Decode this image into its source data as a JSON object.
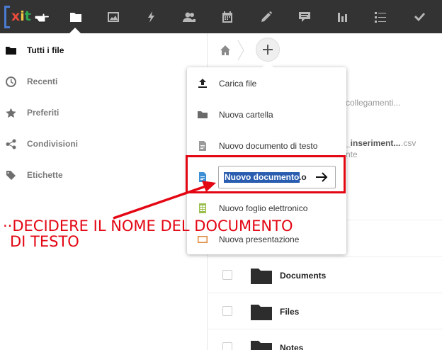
{
  "app": {
    "logo_text": "xit",
    "nav": [
      {
        "icon": "folder-icon",
        "active": true
      },
      {
        "icon": "image-icon"
      },
      {
        "icon": "activity-bolt-icon"
      },
      {
        "icon": "contacts-icon"
      },
      {
        "icon": "calendar-icon"
      },
      {
        "icon": "pencil-icon"
      },
      {
        "icon": "chat-icon"
      },
      {
        "icon": "bar-chart-icon"
      },
      {
        "icon": "list-icon"
      },
      {
        "icon": "checkmark-icon"
      }
    ]
  },
  "sidebar": {
    "items": [
      {
        "label": "Tutti i file",
        "icon": "folder-icon",
        "active": true
      },
      {
        "label": "Recenti",
        "icon": "clock-icon"
      },
      {
        "label": "Preferiti",
        "icon": "star-icon"
      },
      {
        "label": "Condivisioni",
        "icon": "share-icon"
      },
      {
        "label": "Etichette",
        "icon": "tag-icon"
      }
    ]
  },
  "background": {
    "partial_1": "collegamenti...",
    "partial_2": "_inseriment...",
    "partial_2_ext": ".csv",
    "partial_3": "nte"
  },
  "files": [
    {
      "name": "Documents"
    },
    {
      "name": "Files"
    },
    {
      "name": "Notes"
    }
  ],
  "new_menu": {
    "items": [
      {
        "label": "Carica file",
        "icon": "upload-icon"
      },
      {
        "label": "Nuova cartella",
        "icon": "folder-icon"
      },
      {
        "label": "Nuovo documento di testo",
        "icon": "text-file-icon"
      },
      {
        "label": "Nuovo foglio elettronico",
        "icon": "spreadsheet-icon"
      },
      {
        "label": "Nuova presentazione",
        "icon": "presentation-icon"
      }
    ],
    "name_input": {
      "selected_text": "Nuovo documento",
      "extension": ".o"
    }
  },
  "annotation": {
    "dots": "··",
    "line1": "DECIDERE IL NOME DEL DOCUMENTO",
    "line2": "DI TESTO",
    "color": "#e30613"
  }
}
